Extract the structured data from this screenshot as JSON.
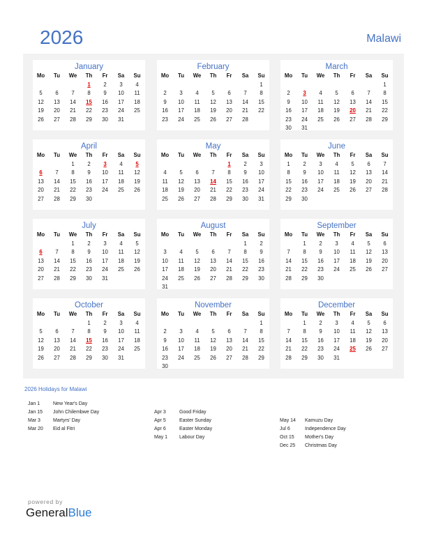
{
  "header": {
    "year": "2026",
    "country": "Malawi"
  },
  "weekdays": [
    "Mo",
    "Tu",
    "We",
    "Th",
    "Fr",
    "Sa",
    "Su"
  ],
  "months": [
    {
      "name": "January",
      "weeks": [
        [
          "",
          "",
          "",
          "1",
          "2",
          "3",
          "4"
        ],
        [
          "5",
          "6",
          "7",
          "8",
          "9",
          "10",
          "11"
        ],
        [
          "12",
          "13",
          "14",
          "15",
          "16",
          "17",
          "18"
        ],
        [
          "19",
          "20",
          "21",
          "22",
          "23",
          "24",
          "25"
        ],
        [
          "26",
          "27",
          "28",
          "29",
          "30",
          "31",
          ""
        ]
      ],
      "holidays": [
        "1",
        "15"
      ]
    },
    {
      "name": "February",
      "weeks": [
        [
          "",
          "",
          "",
          "",
          "",
          "",
          "1"
        ],
        [
          "2",
          "3",
          "4",
          "5",
          "6",
          "7",
          "8"
        ],
        [
          "9",
          "10",
          "11",
          "12",
          "13",
          "14",
          "15"
        ],
        [
          "16",
          "17",
          "18",
          "19",
          "20",
          "21",
          "22"
        ],
        [
          "23",
          "24",
          "25",
          "26",
          "27",
          "28",
          ""
        ]
      ],
      "holidays": []
    },
    {
      "name": "March",
      "weeks": [
        [
          "",
          "",
          "",
          "",
          "",
          "",
          "1"
        ],
        [
          "2",
          "3",
          "4",
          "5",
          "6",
          "7",
          "8"
        ],
        [
          "9",
          "10",
          "11",
          "12",
          "13",
          "14",
          "15"
        ],
        [
          "16",
          "17",
          "18",
          "19",
          "20",
          "21",
          "22"
        ],
        [
          "23",
          "24",
          "25",
          "26",
          "27",
          "28",
          "29"
        ],
        [
          "30",
          "31",
          "",
          "",
          "",
          "",
          ""
        ]
      ],
      "holidays": [
        "3",
        "20"
      ]
    },
    {
      "name": "April",
      "weeks": [
        [
          "",
          "",
          "1",
          "2",
          "3",
          "4",
          "5"
        ],
        [
          "6",
          "7",
          "8",
          "9",
          "10",
          "11",
          "12"
        ],
        [
          "13",
          "14",
          "15",
          "16",
          "17",
          "18",
          "19"
        ],
        [
          "20",
          "21",
          "22",
          "23",
          "24",
          "25",
          "26"
        ],
        [
          "27",
          "28",
          "29",
          "30",
          "",
          "",
          ""
        ]
      ],
      "holidays": [
        "3",
        "5",
        "6"
      ]
    },
    {
      "name": "May",
      "weeks": [
        [
          "",
          "",
          "",
          "",
          "1",
          "2",
          "3"
        ],
        [
          "4",
          "5",
          "6",
          "7",
          "8",
          "9",
          "10"
        ],
        [
          "11",
          "12",
          "13",
          "14",
          "15",
          "16",
          "17"
        ],
        [
          "18",
          "19",
          "20",
          "21",
          "22",
          "23",
          "24"
        ],
        [
          "25",
          "26",
          "27",
          "28",
          "29",
          "30",
          "31"
        ]
      ],
      "holidays": [
        "1",
        "14"
      ]
    },
    {
      "name": "June",
      "weeks": [
        [
          "1",
          "2",
          "3",
          "4",
          "5",
          "6",
          "7"
        ],
        [
          "8",
          "9",
          "10",
          "11",
          "12",
          "13",
          "14"
        ],
        [
          "15",
          "16",
          "17",
          "18",
          "19",
          "20",
          "21"
        ],
        [
          "22",
          "23",
          "24",
          "25",
          "26",
          "27",
          "28"
        ],
        [
          "29",
          "30",
          "",
          "",
          "",
          "",
          ""
        ]
      ],
      "holidays": []
    },
    {
      "name": "July",
      "weeks": [
        [
          "",
          "",
          "1",
          "2",
          "3",
          "4",
          "5"
        ],
        [
          "6",
          "7",
          "8",
          "9",
          "10",
          "11",
          "12"
        ],
        [
          "13",
          "14",
          "15",
          "16",
          "17",
          "18",
          "19"
        ],
        [
          "20",
          "21",
          "22",
          "23",
          "24",
          "25",
          "26"
        ],
        [
          "27",
          "28",
          "29",
          "30",
          "31",
          "",
          ""
        ]
      ],
      "holidays": [
        "6"
      ]
    },
    {
      "name": "August",
      "weeks": [
        [
          "",
          "",
          "",
          "",
          "",
          "1",
          "2"
        ],
        [
          "3",
          "4",
          "5",
          "6",
          "7",
          "8",
          "9"
        ],
        [
          "10",
          "11",
          "12",
          "13",
          "14",
          "15",
          "16"
        ],
        [
          "17",
          "18",
          "19",
          "20",
          "21",
          "22",
          "23"
        ],
        [
          "24",
          "25",
          "26",
          "27",
          "28",
          "29",
          "30"
        ],
        [
          "31",
          "",
          "",
          "",
          "",
          "",
          ""
        ]
      ],
      "holidays": []
    },
    {
      "name": "September",
      "weeks": [
        [
          "",
          "1",
          "2",
          "3",
          "4",
          "5",
          "6"
        ],
        [
          "7",
          "8",
          "9",
          "10",
          "11",
          "12",
          "13"
        ],
        [
          "14",
          "15",
          "16",
          "17",
          "18",
          "19",
          "20"
        ],
        [
          "21",
          "22",
          "23",
          "24",
          "25",
          "26",
          "27"
        ],
        [
          "28",
          "29",
          "30",
          "",
          "",
          "",
          ""
        ]
      ],
      "holidays": []
    },
    {
      "name": "October",
      "weeks": [
        [
          "",
          "",
          "",
          "1",
          "2",
          "3",
          "4"
        ],
        [
          "5",
          "6",
          "7",
          "8",
          "9",
          "10",
          "11"
        ],
        [
          "12",
          "13",
          "14",
          "15",
          "16",
          "17",
          "18"
        ],
        [
          "19",
          "20",
          "21",
          "22",
          "23",
          "24",
          "25"
        ],
        [
          "26",
          "27",
          "28",
          "29",
          "30",
          "31",
          ""
        ]
      ],
      "holidays": [
        "15"
      ]
    },
    {
      "name": "November",
      "weeks": [
        [
          "",
          "",
          "",
          "",
          "",
          "",
          "1"
        ],
        [
          "2",
          "3",
          "4",
          "5",
          "6",
          "7",
          "8"
        ],
        [
          "9",
          "10",
          "11",
          "12",
          "13",
          "14",
          "15"
        ],
        [
          "16",
          "17",
          "18",
          "19",
          "20",
          "21",
          "22"
        ],
        [
          "23",
          "24",
          "25",
          "26",
          "27",
          "28",
          "29"
        ],
        [
          "30",
          "",
          "",
          "",
          "",
          "",
          ""
        ]
      ],
      "holidays": []
    },
    {
      "name": "December",
      "weeks": [
        [
          "",
          "1",
          "2",
          "3",
          "4",
          "5",
          "6"
        ],
        [
          "7",
          "8",
          "9",
          "10",
          "11",
          "12",
          "13"
        ],
        [
          "14",
          "15",
          "16",
          "17",
          "18",
          "19",
          "20"
        ],
        [
          "21",
          "22",
          "23",
          "24",
          "25",
          "26",
          "27"
        ],
        [
          "28",
          "29",
          "30",
          "31",
          "",
          "",
          ""
        ]
      ],
      "holidays": [
        "25"
      ]
    }
  ],
  "holidays_section": {
    "title": "2026 Holidays for Malawi",
    "columns": [
      [
        {
          "date": "Jan 1",
          "name": "New Year's Day"
        },
        {
          "date": "Jan 15",
          "name": "John Chilembwe Day"
        },
        {
          "date": "Mar 3",
          "name": "Martyrs' Day"
        },
        {
          "date": "Mar 20",
          "name": "Eid al Fitri"
        }
      ],
      [
        {
          "date": "Apr 3",
          "name": "Good Friday"
        },
        {
          "date": "Apr 5",
          "name": "Easter Sunday"
        },
        {
          "date": "Apr 6",
          "name": "Easter Monday"
        },
        {
          "date": "May 1",
          "name": "Labour Day"
        }
      ],
      [
        {
          "date": "May 14",
          "name": "Kamuzu Day"
        },
        {
          "date": "Jul 6",
          "name": "Independence Day"
        },
        {
          "date": "Oct 15",
          "name": "Mother's Day"
        },
        {
          "date": "Dec 25",
          "name": "Christmas Day"
        }
      ]
    ]
  },
  "footer": {
    "powered_by": "powered by",
    "brand_general": "General",
    "brand_blue": "Blue"
  }
}
